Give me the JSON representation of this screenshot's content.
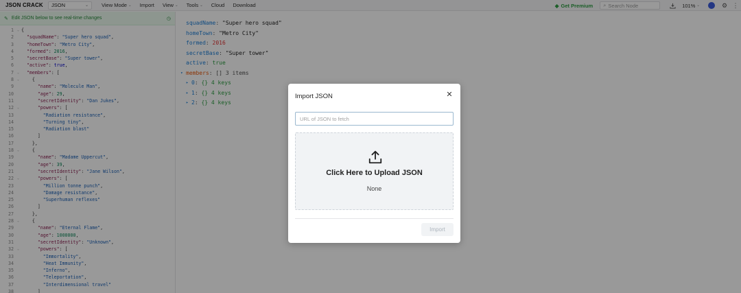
{
  "app": {
    "logo": "JSON CRACK",
    "format": "JSON",
    "menu": [
      "View Mode",
      "Import",
      "View",
      "Tools",
      "Cloud",
      "Download"
    ],
    "premium": "Get Premium",
    "search_placeholder": "Search Node",
    "zoom": "101%"
  },
  "editor": {
    "banner": "Edit JSON below to see real-time changes",
    "lines": [
      "{",
      "  \"squadName\": \"Super hero squad\",",
      "  \"homeTown\": \"Metro City\",",
      "  \"formed\": 2016,",
      "  \"secretBase\": \"Super tower\",",
      "  \"active\": true,",
      "  \"members\": [",
      "    {",
      "      \"name\": \"Molecule Man\",",
      "      \"age\": 29,",
      "      \"secretIdentity\": \"Dan Jukes\",",
      "      \"powers\": [",
      "        \"Radiation resistance\",",
      "        \"Turning tiny\",",
      "        \"Radiation blast\"",
      "      ]",
      "    },",
      "    {",
      "      \"name\": \"Madame Uppercut\",",
      "      \"age\": 39,",
      "      \"secretIdentity\": \"Jane Wilson\",",
      "      \"powers\": [",
      "        \"Million tonne punch\",",
      "        \"Damage resistance\",",
      "        \"Superhuman reflexes\"",
      "      ]",
      "    },",
      "    {",
      "      \"name\": \"Eternal Flame\",",
      "      \"age\": 1000000,",
      "      \"secretIdentity\": \"Unknown\",",
      "      \"powers\": [",
      "        \"Immortality\",",
      "        \"Heat Immunity\",",
      "        \"Inferno\",",
      "        \"Teleportation\",",
      "        \"Interdimensional travel\"",
      "      ]"
    ]
  },
  "tree": {
    "rows": [
      {
        "key": "squadName",
        "value": "\"Super hero squad\"",
        "kind": "str"
      },
      {
        "key": "homeTown",
        "value": "\"Metro City\"",
        "kind": "str"
      },
      {
        "key": "formed",
        "value": "2016",
        "kind": "num"
      },
      {
        "key": "secretBase",
        "value": "\"Super tower\"",
        "kind": "str"
      },
      {
        "key": "active",
        "value": "true",
        "kind": "bool"
      }
    ],
    "members": {
      "key": "members",
      "bracket": "[]",
      "count": "3 items"
    },
    "children": [
      {
        "index": "0",
        "bracket": "{}",
        "count": "4 keys"
      },
      {
        "index": "1",
        "bracket": "{}",
        "count": "4 keys"
      },
      {
        "index": "2",
        "bracket": "{}",
        "count": "4 keys"
      }
    ]
  },
  "modal": {
    "title": "Import JSON",
    "url_placeholder": "URL of JSON to fetch",
    "upload_label": "Click Here to Upload JSON",
    "file_name": "None",
    "import_label": "Import"
  }
}
